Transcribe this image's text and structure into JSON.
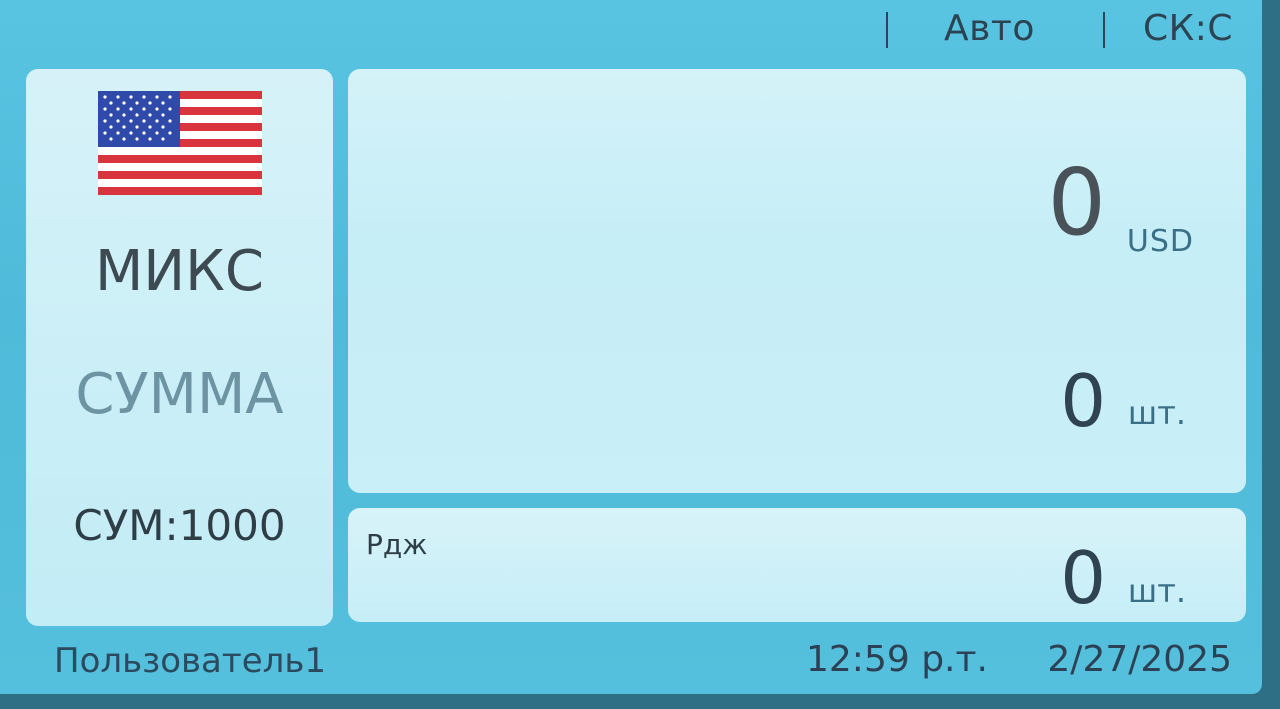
{
  "status_bar": {
    "mode": "Авто",
    "speed": "СК:С"
  },
  "left_panel": {
    "flag_icon": "us-flag-icon",
    "mode": "МИКС",
    "function": "СУММА",
    "sum_setting": "СУМ:1000"
  },
  "main_panel": {
    "amount": "0",
    "currency": "USD",
    "count": "0",
    "count_unit": "шт."
  },
  "reject_panel": {
    "label": "Рдж",
    "count": "0",
    "count_unit": "шт."
  },
  "footer": {
    "user": "Пользователь1",
    "time": "12:59 р.т.",
    "date": "2/27/2025"
  },
  "colors": {
    "screen_bg": "#55c0dd",
    "panel_bg": "#c8eef7",
    "text_dark": "#2f4450"
  }
}
